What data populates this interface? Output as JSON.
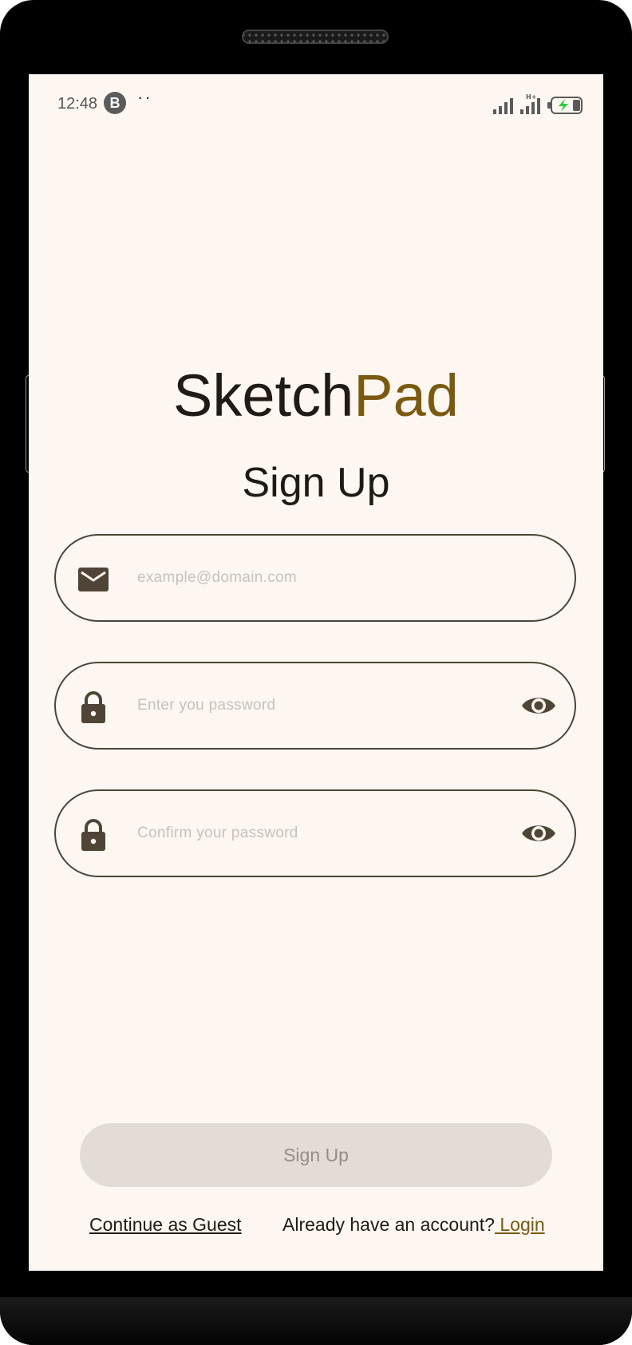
{
  "status_bar": {
    "time": "12:48",
    "badge_letter": "B",
    "notification_dots": "··",
    "icons": [
      "signal-icon",
      "signal-h-plus-icon",
      "battery-charging-icon"
    ]
  },
  "app": {
    "title_part1": "Sketch",
    "title_part2": "Pad",
    "accent_color": "#7a5a10"
  },
  "page": {
    "title": "Sign Up"
  },
  "form": {
    "email": {
      "placeholder": "example@domain.com",
      "icon": "mail-icon"
    },
    "password": {
      "placeholder": "Enter you password",
      "icon": "lock-icon",
      "toggle_icon": "eye-icon"
    },
    "confirm_password": {
      "placeholder": "Confirm your password",
      "icon": "lock-icon",
      "toggle_icon": "eye-icon"
    }
  },
  "actions": {
    "signup_label": "Sign Up",
    "guest_label": "Continue as Guest",
    "account_prompt": "Already have an account?",
    "login_label": " Login"
  }
}
